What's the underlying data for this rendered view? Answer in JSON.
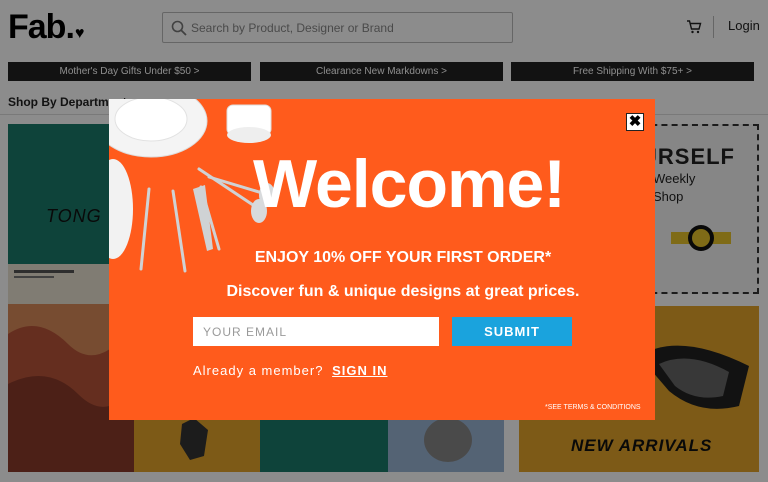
{
  "header": {
    "logo": "Fab.",
    "search_placeholder": "Search by Product, Designer or Brand",
    "login_label": "Login"
  },
  "promos": [
    {
      "label": "Mother's Day Gifts Under $50  >"
    },
    {
      "label": "Clearance New Markdowns  >"
    },
    {
      "label": "Free Shipping With $75+  >"
    }
  ],
  "nav": {
    "first_item": "Shop By Department"
  },
  "tiles": {
    "tongue_label": "TONG",
    "watch_title": "URSELF",
    "watch_sub1": "Weekly",
    "watch_sub2": "Shop",
    "arrivals_label": "NEW ARRIVALS"
  },
  "modal": {
    "title": "Welcome!",
    "offer": "ENJOY 10% OFF YOUR FIRST ORDER*",
    "tagline": "Discover fun & unique designs at great prices.",
    "email_placeholder": "YOUR EMAIL",
    "submit_label": "SUBMIT",
    "member_prompt": "Already a member?",
    "signin_label": "SIGN IN",
    "terms": "*SEE TERMS & CONDITIONS",
    "close_glyph": "✖"
  },
  "colors": {
    "modal_bg": "#ff5b1c",
    "submit_bg": "#1aa3dd",
    "promo_bg": "#222222"
  }
}
